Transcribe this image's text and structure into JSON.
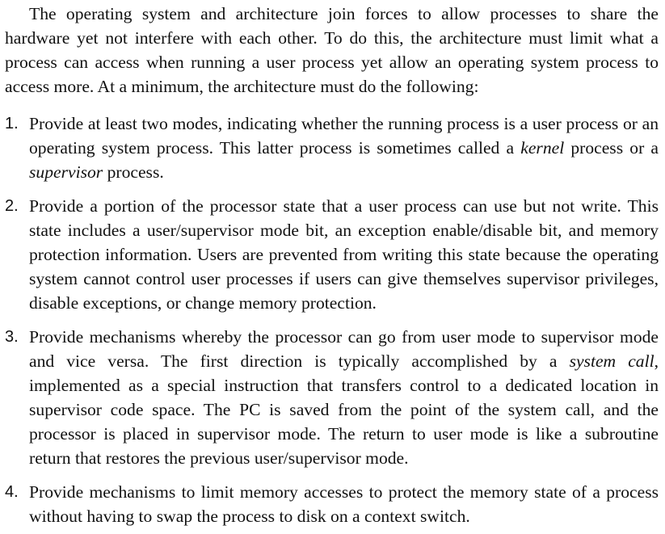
{
  "intro": "The operating system and architecture join forces to allow processes to share the hardware yet not interfere with each other. To do this, the architecture must limit what a process can access when running a user process yet allow an operating sys­tem process to access more. At a minimum, the architecture must do the following:",
  "items": [
    {
      "number": "1.",
      "text_a": "Provide at least two modes, indicating whether the running process is a user process or an operating system process. This latter process is sometimes called a ",
      "em_a": "kernel",
      "text_b": " process or a ",
      "em_b": "supervisor",
      "text_c": " process."
    },
    {
      "number": "2.",
      "text": "Provide a portion of the processor state that a user process can use but not write. This state includes a user/supervisor mode bit, an exception enable/disable bit, and memory protection information. Users are prevented from writing this state because the operating system cannot control user processes if users can give them­selves supervisor privileges, disable exceptions, or change memory protection."
    },
    {
      "number": "3.",
      "text_a": "Provide mechanisms whereby the processor can go from user mode to super­visor mode and vice versa. The first direction is typically accomplished by a ",
      "em": "system call",
      "text_b": ", implemented as a special instruction that transfers control to a ded­icated location in supervisor code space. The PC is saved from the point of the system call, and the processor is placed in supervisor mode. The return to user mode is like a subroutine return that restores the previous user/supervisor mode."
    },
    {
      "number": "4.",
      "text": "Provide mechanisms to limit memory accesses to protect the memory state of a process without having to swap the process to disk on a context switch."
    }
  ]
}
